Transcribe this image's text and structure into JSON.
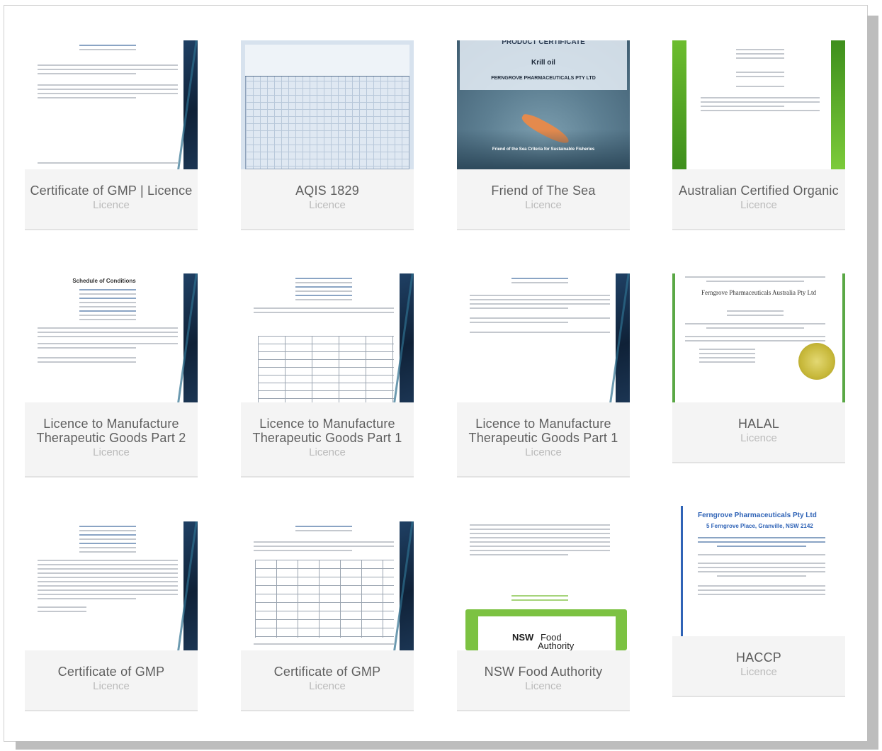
{
  "cards": [
    {
      "title": "Certificate of GMP | Licence",
      "subtitle": "Licence"
    },
    {
      "title": "AQIS 1829",
      "subtitle": "Licence"
    },
    {
      "title": "Friend of The Sea",
      "subtitle": "Licence"
    },
    {
      "title": "Australian Certified Organic",
      "subtitle": "Licence"
    },
    {
      "title_line1": "Licence to Manufacture",
      "title_line2": "Therapeutic Goods Part 2",
      "subtitle": "Licence"
    },
    {
      "title_line1": "Licence to Manufacture",
      "title_line2": "Therapeutic Goods Part 1",
      "subtitle": "Licence"
    },
    {
      "title_line1": "Licence to Manufacture",
      "title_line2": "Therapeutic Goods Part 1",
      "subtitle": "Licence"
    },
    {
      "title": "HALAL",
      "subtitle": "Licence"
    },
    {
      "title": "Certificate of GMP",
      "subtitle": "Licence"
    },
    {
      "title": "Certificate of GMP",
      "subtitle": "Licence"
    },
    {
      "title": "NSW Food Authority",
      "subtitle": "Licence"
    },
    {
      "title": "HACCP",
      "subtitle": "Licence"
    }
  ],
  "thumb_text": {
    "sea_header": "PRODUCT CERTIFICATE",
    "sea_krill": "Krill oil",
    "sea_company": "FERNGROVE PHARMACEUTICALS PTY LTD",
    "sea_criteria": "Friend of the Sea Criteria for Sustainable Fisheries",
    "schedule_title": "Schedule of Conditions",
    "halal_company": "Ferngrove Pharmaceuticals Australia Pty Ltd",
    "nsw_logo": "NSW",
    "nsw_food": "Food",
    "nsw_authority": "Authority",
    "haccp_company": "Ferngrove Pharmaceuticals Pty Ltd",
    "haccp_address": "5 Ferngrove Place, Granville, NSW 2142"
  },
  "colors": {
    "card_bg": "#f4f4f4",
    "title": "#5e5e5e",
    "subtitle": "#bbbbbb",
    "navy_band": "#1f4064"
  },
  "icons": [
    "certificate-thumbnail"
  ]
}
